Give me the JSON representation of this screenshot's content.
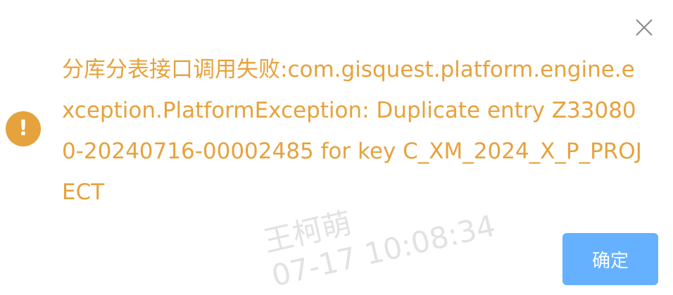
{
  "dialog": {
    "message": "分库分表接口调用失败:com.gisquest.platform.engine.exception.PlatformException: Duplicate entry Z330800-20240716-00002485 for key C_XM_2024_X_P_PROJECT",
    "icon": "warning-icon",
    "close_icon": "close-icon",
    "confirm_label": "确定",
    "warning_color": "#e6a23c",
    "button_color": "#66b1ff"
  },
  "watermark": {
    "name": "王柯萌",
    "time": "07-17 10:08:34"
  }
}
